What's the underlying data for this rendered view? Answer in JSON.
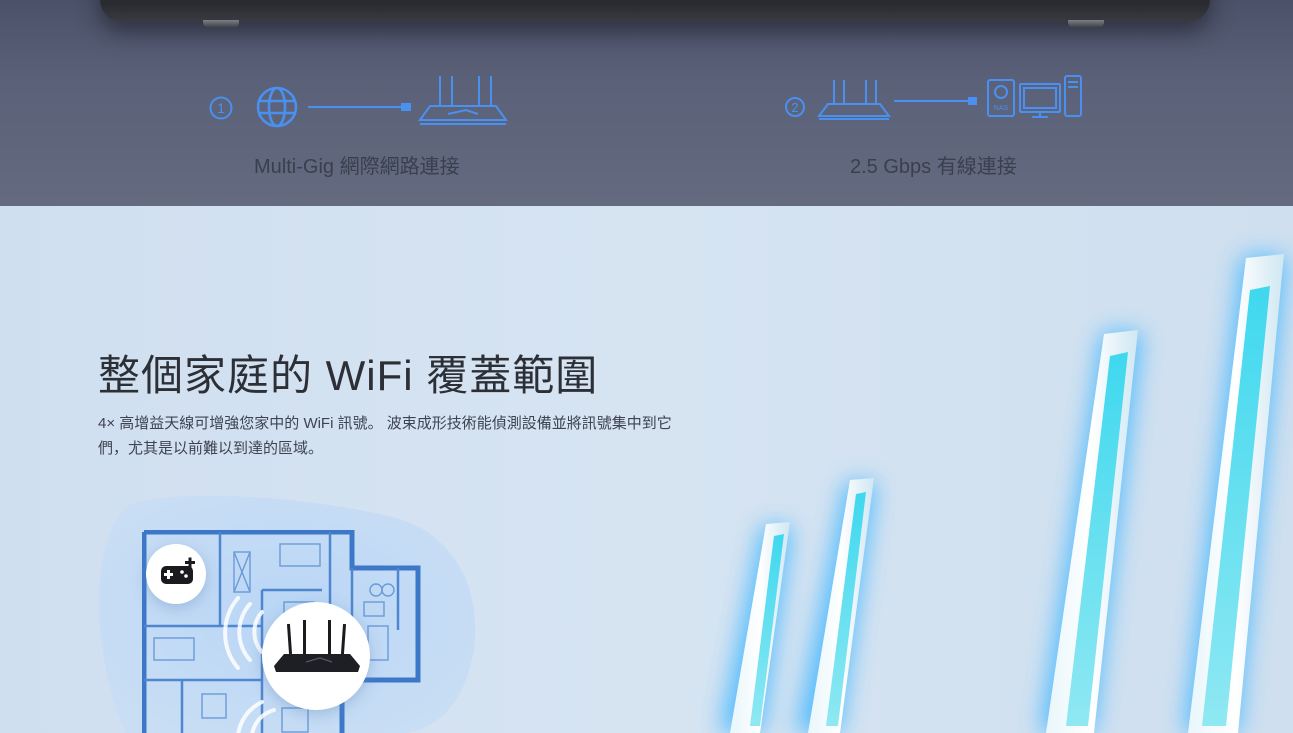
{
  "connections": [
    {
      "step": "1",
      "label": "Multi-Gig 網際網路連接",
      "icons": [
        "globe-icon",
        "router-icon"
      ]
    },
    {
      "step": "2",
      "label": "2.5 Gbps 有線連接",
      "icons": [
        "router-icon",
        "nas-icon",
        "monitor-icon",
        "pc-tower-icon"
      ]
    }
  ],
  "nas_icon_text": "NAS",
  "wifi_section": {
    "title": "整個家庭的 WiFi 覆蓋範圍",
    "description": "4× 高增益天線可增強您家中的 WiFi 訊號。 波束成形技術能偵測設備並將訊號集中到它們，尤其是以前難以到達的區域。",
    "floorplan_icons": [
      "gamepad-icon",
      "router-icon",
      "wifi-signal-icon"
    ]
  },
  "colors": {
    "accent_blue": "#4a90f0",
    "top_band": "#5a6178",
    "section_bg": "#d3e2f1",
    "antenna_glow": "#4fd6f0"
  }
}
